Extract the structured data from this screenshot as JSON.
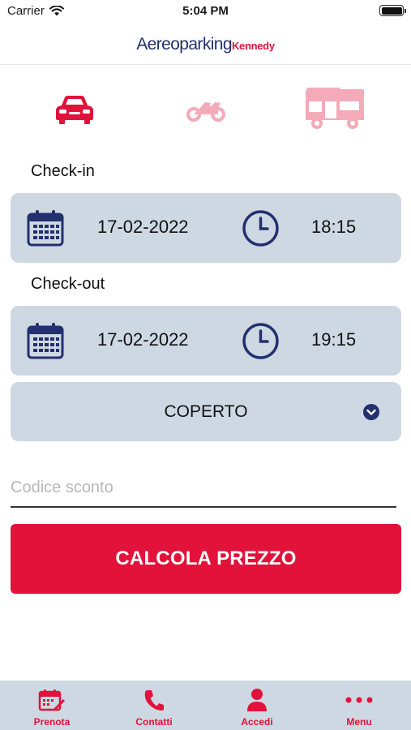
{
  "status_bar": {
    "carrier": "Carrier",
    "time": "5:04 PM"
  },
  "header": {
    "logo_main": "Aereoparking",
    "logo_sub": "Kennedy"
  },
  "vehicle_selector": [
    {
      "name": "car",
      "icon": "car-icon",
      "selected": true,
      "color": "#e2123a"
    },
    {
      "name": "motorcycle",
      "icon": "motorcycle-icon",
      "selected": false,
      "color": "#f4aab8"
    },
    {
      "name": "camper",
      "icon": "camper-icon",
      "selected": false,
      "color": "#f4aab8"
    }
  ],
  "checkin": {
    "label": "Check-in",
    "date": "17-02-2022",
    "time": "18:15"
  },
  "checkout": {
    "label": "Check-out",
    "date": "17-02-2022",
    "time": "19:15"
  },
  "parking_type": {
    "selected": "COPERTO"
  },
  "discount": {
    "placeholder": "Codice sconto",
    "value": ""
  },
  "cta": {
    "label": "CALCOLA PREZZO"
  },
  "tab_bar": {
    "items": [
      {
        "label": "Prenota",
        "icon": "calendar-edit-icon"
      },
      {
        "label": "Contatti",
        "icon": "phone-icon"
      },
      {
        "label": "Accedi",
        "icon": "user-icon"
      },
      {
        "label": "Menu",
        "icon": "more-dots-icon"
      }
    ]
  },
  "colors": {
    "brand_red": "#e2123a",
    "brand_navy": "#23306e",
    "panel": "#cdd8e3"
  }
}
